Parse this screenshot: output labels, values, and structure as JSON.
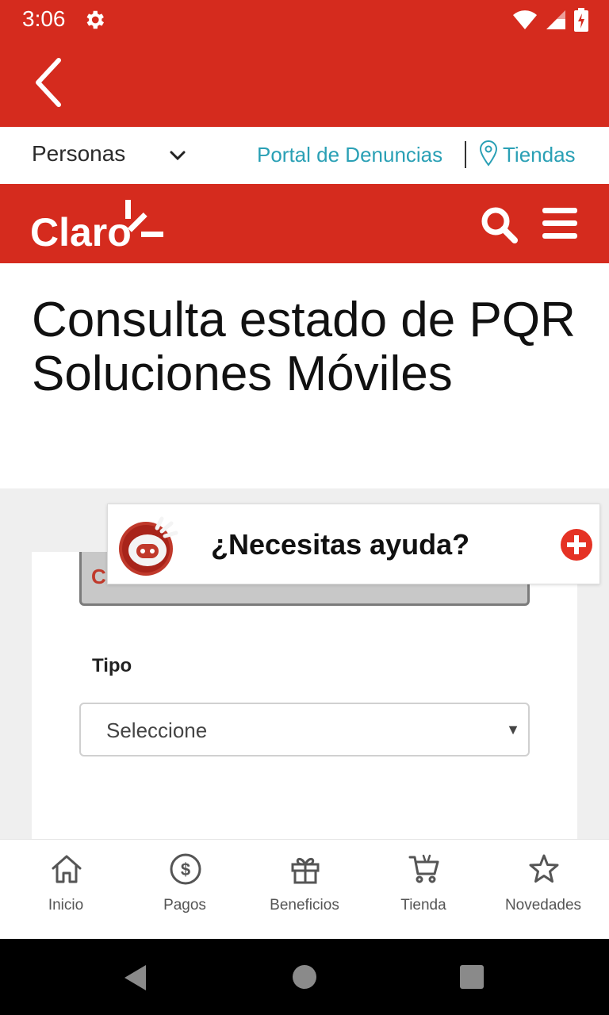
{
  "status_bar": {
    "time": "3:06"
  },
  "top_nav": {
    "personas_label": "Personas",
    "portal_label": "Portal de Denuncias",
    "tiendas_label": "Tiendas"
  },
  "header": {
    "logo_text": "Claro"
  },
  "page": {
    "title": "Consulta estado de PQR Soluciones Móviles"
  },
  "form": {
    "hidden_select_partial": "Claro te escucha",
    "tipo_label": "Tipo",
    "tipo_value": "Seleccione"
  },
  "help_widget": {
    "text": "¿Necesitas ayuda?"
  },
  "bottom_nav": {
    "items": [
      {
        "label": "Inicio",
        "icon": "home-icon"
      },
      {
        "label": "Pagos",
        "icon": "dollar-icon"
      },
      {
        "label": "Beneficios",
        "icon": "gift-icon"
      },
      {
        "label": "Tienda",
        "icon": "cart-icon"
      },
      {
        "label": "Novedades",
        "icon": "star-icon"
      }
    ]
  },
  "colors": {
    "brand_red": "#d52b1e",
    "link_teal": "#2aa0b5"
  }
}
